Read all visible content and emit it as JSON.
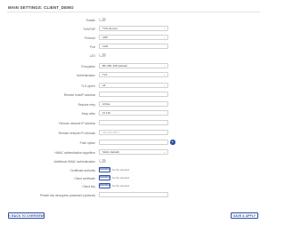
{
  "page": {
    "title": "MAIN SETTINGS: CLIENT_DEMO"
  },
  "form": {
    "rows": [
      {
        "label": "Enable",
        "type": "toggle"
      },
      {
        "label": "TUN/TAP",
        "type": "select",
        "value": "TUN (tunnel)"
      },
      {
        "label": "Protocol",
        "type": "select",
        "value": "UDP"
      },
      {
        "label": "Port",
        "type": "input",
        "value": "1194"
      },
      {
        "label": "LZO",
        "type": "toggle"
      },
      {
        "label": "Encryption",
        "type": "select",
        "value": "BF-CBC 128 (default)"
      },
      {
        "label": "Authentication",
        "type": "select",
        "value": "TLS"
      },
      {
        "label": "TLS cipher",
        "type": "select",
        "value": "All"
      },
      {
        "label": "Remote host/IP address",
        "type": "input",
        "value": ""
      },
      {
        "label": "Resolve retry",
        "type": "input",
        "value": "infinite"
      },
      {
        "label": "Keep alive",
        "type": "input",
        "value": "10 120"
      },
      {
        "label": "Remote network IP address",
        "type": "input",
        "value": ""
      },
      {
        "label": "Remote network IP netmask",
        "type": "input",
        "value": "255.255.255.0",
        "placeholder": true
      },
      {
        "label": "Push option",
        "type": "input-add",
        "value": ""
      },
      {
        "label": "HMAC authentication algorithm",
        "type": "select",
        "value": "SHA1 (default)"
      },
      {
        "label": "Additional HMAC authentication",
        "type": "toggle"
      },
      {
        "label": "Certificate authority",
        "type": "file",
        "button": "BROWSE",
        "status": "No file selected"
      },
      {
        "label": "Client certificate",
        "type": "file",
        "button": "BROWSE",
        "status": "No file selected"
      },
      {
        "label": "Client key",
        "type": "file",
        "button": "BROWSE",
        "status": "No file selected"
      },
      {
        "label": "Private key decryption password (optional)",
        "type": "input",
        "value": ""
      }
    ]
  },
  "footer": {
    "back_label": "< BACK TO OVERVIEW",
    "save_label": "SAVE & APPLY"
  },
  "colors": {
    "accent": "#2b4ea2",
    "toggle_off": "#cfcfcf"
  },
  "icons": {
    "dropdown": "chevron-down-icon",
    "add": "plus-icon"
  }
}
